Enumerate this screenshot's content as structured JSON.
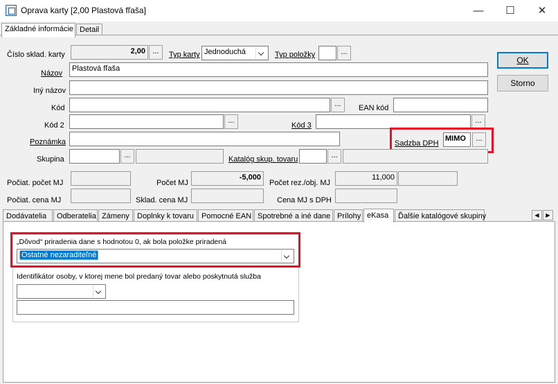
{
  "window": {
    "title": "Oprava karty [2,00  Plastová fľaša]",
    "minimize_glyph": "—",
    "maximize_glyph": "☐",
    "close_glyph": "✕"
  },
  "top_tabs": [
    {
      "label": "Základné informácie",
      "active": true
    },
    {
      "label": "Detail",
      "active": false
    }
  ],
  "form": {
    "cislo_label": "Číslo sklad. karty",
    "cislo_value": "2,00",
    "typ_karty_label": "Typ karty",
    "typ_karty_value": "Jednoduchá",
    "typ_polozky_label": "Typ položky",
    "nazov_label": "Názov",
    "nazov_value": "Plastová fľaša",
    "iny_nazov_label": "Iný názov",
    "kod_label": "Kód",
    "ean_label": "EAN kód",
    "kod2_label": "Kód 2",
    "kod3_label": "Kód 3",
    "poznamka_label": "Poznámka",
    "sadzba_label": "Sadzba DPH",
    "sadzba_value": "MIMO",
    "skupina_label": "Skupina",
    "katalog_label": "Katalóg skup. tovaru",
    "pocat_pocet_label": "Počiat. počet MJ",
    "pocet_label": "Počet MJ",
    "pocet_value": "-5,000",
    "pocet_rez_label": "Počet rez./obj. MJ",
    "pocet_rez_value": "11,000",
    "pocat_cena_label": "Počiat. cena MJ",
    "sklad_cena_label": "Sklad. cena MJ",
    "cena_dph_label": "Cena MJ s DPH",
    "ellipsis": "..."
  },
  "buttons": {
    "ok": "OK",
    "storno": "Storno"
  },
  "sub_tabs": [
    {
      "label": "Dodávatelia",
      "active": false
    },
    {
      "label": "Odberatelia",
      "active": false
    },
    {
      "label": "Zámeny",
      "active": false
    },
    {
      "label": "Doplnky k tovaru",
      "active": false
    },
    {
      "label": "Pomocné EAN",
      "active": false
    },
    {
      "label": "Spotrebné a iné dane",
      "active": false
    },
    {
      "label": "Prílohy",
      "active": false
    },
    {
      "label": "eKasa",
      "active": true
    },
    {
      "label": "Ďalšie katalógové skupiny",
      "active": false
    }
  ],
  "ekasa": {
    "dovod_label": "„Dôvod“ priradenia dane s hodnotou 0, ak bola položke priradená",
    "dovod_value": "Ostatné nezaraditeľné",
    "identifikator_label": "Identifikátor osoby, v ktorej mene bol predaný tovar alebo poskytnutá služba",
    "identifikator_value": ""
  },
  "colors": {
    "highlight_red": "#e81123",
    "selection_blue": "#0078d7"
  }
}
